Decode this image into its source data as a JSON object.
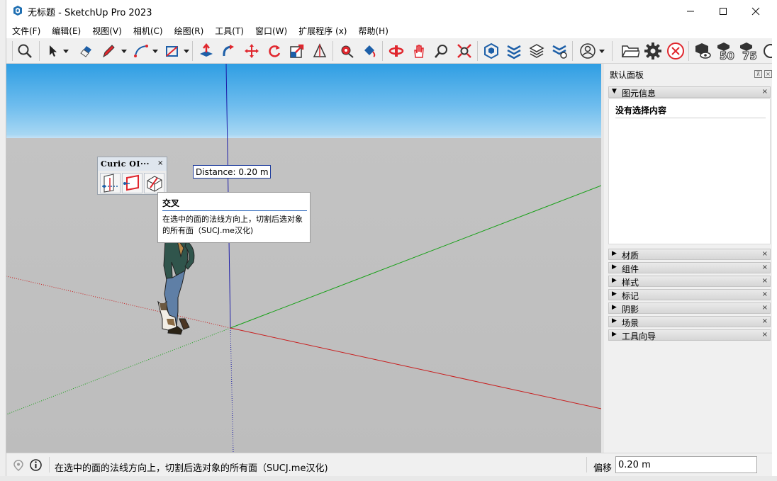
{
  "window": {
    "title": "无标题 - SketchUp Pro 2023",
    "controls": {
      "minimize": "—",
      "maximize": "☐",
      "close": "✕"
    }
  },
  "menu": [
    {
      "label": "文件(F)"
    },
    {
      "label": "编辑(E)"
    },
    {
      "label": "视图(V)"
    },
    {
      "label": "相机(C)"
    },
    {
      "label": "绘图(R)"
    },
    {
      "label": "工具(T)"
    },
    {
      "label": "窗口(W)"
    },
    {
      "label": "扩展程序 (x)"
    },
    {
      "label": "帮助(H)"
    }
  ],
  "toolbar": {
    "icons": [
      "search-icon",
      "select-arrow-icon",
      "eraser-icon",
      "pencil-icon",
      "arc-icon",
      "rectangle-icon",
      "push-pull-icon",
      "follow-me-icon",
      "move-icon",
      "rotate-icon",
      "scale-icon",
      "section-icon",
      "tape-measure-icon",
      "paint-bucket-icon",
      "orbit-icon",
      "pan-icon",
      "zoom-icon",
      "zoom-extents-icon",
      "component-3d-icon",
      "layers-icon",
      "stack-icon",
      "settings-sliders-icon",
      "account-icon",
      "folder-icon",
      "gear-icon",
      "cancel-icon",
      "view-eye-icon",
      "bubble-50-icon",
      "bubble-75-icon"
    ],
    "bubble_labels": {
      "b50": "50",
      "b75": "75"
    },
    "colors": {
      "red": "#e0262d",
      "blue": "#1d5fa8",
      "dark": "#333333"
    }
  },
  "floating_toolbar": {
    "title": "Curic OI···",
    "close": "×",
    "buttons": [
      "slice-icon",
      "intersect-face-icon",
      "cut-solid-icon"
    ]
  },
  "distance_tooltip": "Distance: 0.20 m",
  "intersect_tooltip": {
    "title": "交叉",
    "body": "在选中的面的法线方向上，切割后选对象的所有面（SUCJ.me汉化)"
  },
  "tray": {
    "title": "默认面板",
    "pin": "⊼",
    "close": "×",
    "entity_info": {
      "label": "图元信息",
      "content": "没有选择内容"
    },
    "sections": [
      {
        "label": "材质"
      },
      {
        "label": "组件"
      },
      {
        "label": "样式"
      },
      {
        "label": "标记"
      },
      {
        "label": "阴影"
      },
      {
        "label": "场景"
      },
      {
        "label": "工具向导"
      }
    ],
    "expanded_glyph": "▼",
    "collapsed_glyph": "▶",
    "section_close": "×"
  },
  "status": {
    "text": "在选中的面的法线方向上，切割后选对象的所有面（SUCJ.me汉化)",
    "measurements_label": "偏移",
    "measurements_value": "0.20 m"
  }
}
